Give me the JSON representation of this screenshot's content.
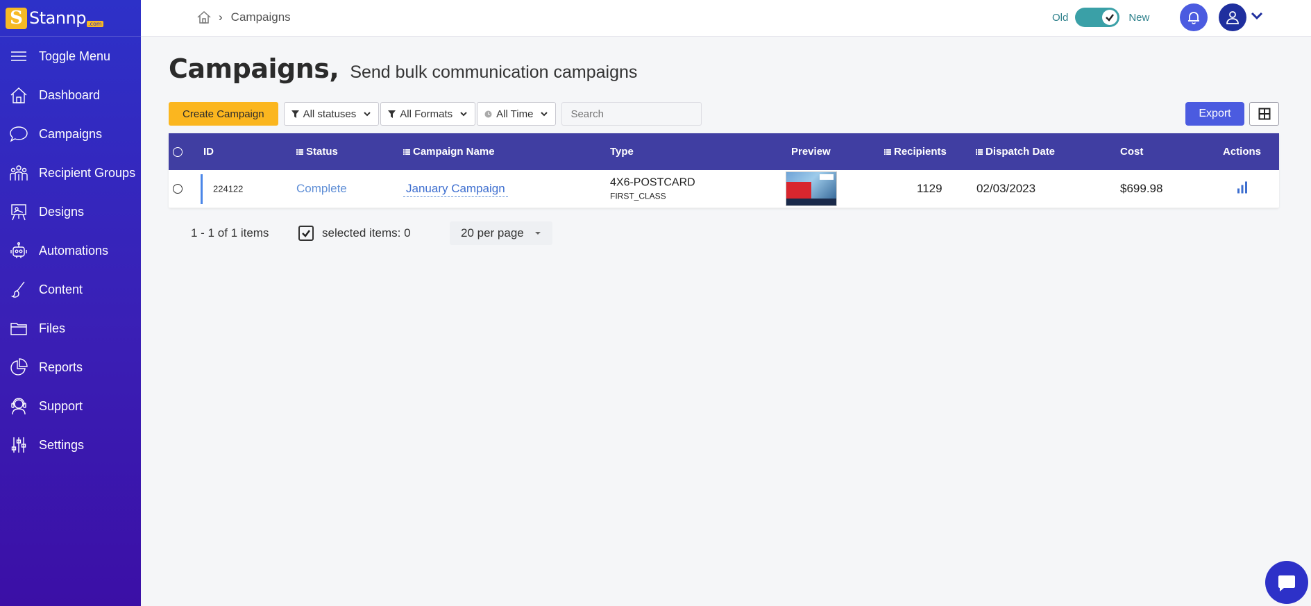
{
  "brand": {
    "name": "Stannp",
    "suffix": ".com",
    "badge": "S"
  },
  "sidebar": {
    "items": [
      {
        "label": "Toggle Menu",
        "icon": "menu-icon"
      },
      {
        "label": "Dashboard",
        "icon": "home-icon"
      },
      {
        "label": "Campaigns",
        "icon": "chat-bubble-icon"
      },
      {
        "label": "Recipient Groups",
        "icon": "group-icon"
      },
      {
        "label": "Designs",
        "icon": "easel-icon"
      },
      {
        "label": "Automations",
        "icon": "robot-icon"
      },
      {
        "label": "Content",
        "icon": "brush-icon"
      },
      {
        "label": "Files",
        "icon": "folder-icon"
      },
      {
        "label": "Reports",
        "icon": "pie-chart-icon"
      },
      {
        "label": "Support",
        "icon": "headset-icon"
      },
      {
        "label": "Settings",
        "icon": "sliders-icon"
      }
    ]
  },
  "header": {
    "breadcrumb": "Campaigns",
    "toggle_old": "Old",
    "toggle_new": "New"
  },
  "page": {
    "title": "Campaigns,",
    "subtitle": "Send bulk communication campaigns"
  },
  "toolbar": {
    "create_label": "Create Campaign",
    "filter_status": "All statuses",
    "filter_formats": "All Formats",
    "filter_time": "All Time",
    "search_placeholder": "Search",
    "export_label": "Export"
  },
  "table": {
    "columns": {
      "id": "ID",
      "status": "Status",
      "name": "Campaign Name",
      "type": "Type",
      "preview": "Preview",
      "recipients": "Recipients",
      "dispatch": "Dispatch Date",
      "cost": "Cost",
      "actions": "Actions"
    },
    "rows": [
      {
        "id": "224122",
        "status": "Complete",
        "name": "January Campaign",
        "type": "4X6-POSTCARD",
        "type_sub": "FIRST_CLASS",
        "recipients": "1129",
        "dispatch": "02/03/2023",
        "cost": "$699.98"
      }
    ]
  },
  "pager": {
    "count": "1 - 1 of 1 items",
    "selected": "selected items: 0",
    "per_page": "20 per page"
  },
  "colors": {
    "accent": "#4b5be0",
    "header_row": "#403ea2",
    "create_button": "#fbb61f",
    "sidebar_top": "#2d31c8",
    "sidebar_bottom": "#3b0fa6"
  }
}
